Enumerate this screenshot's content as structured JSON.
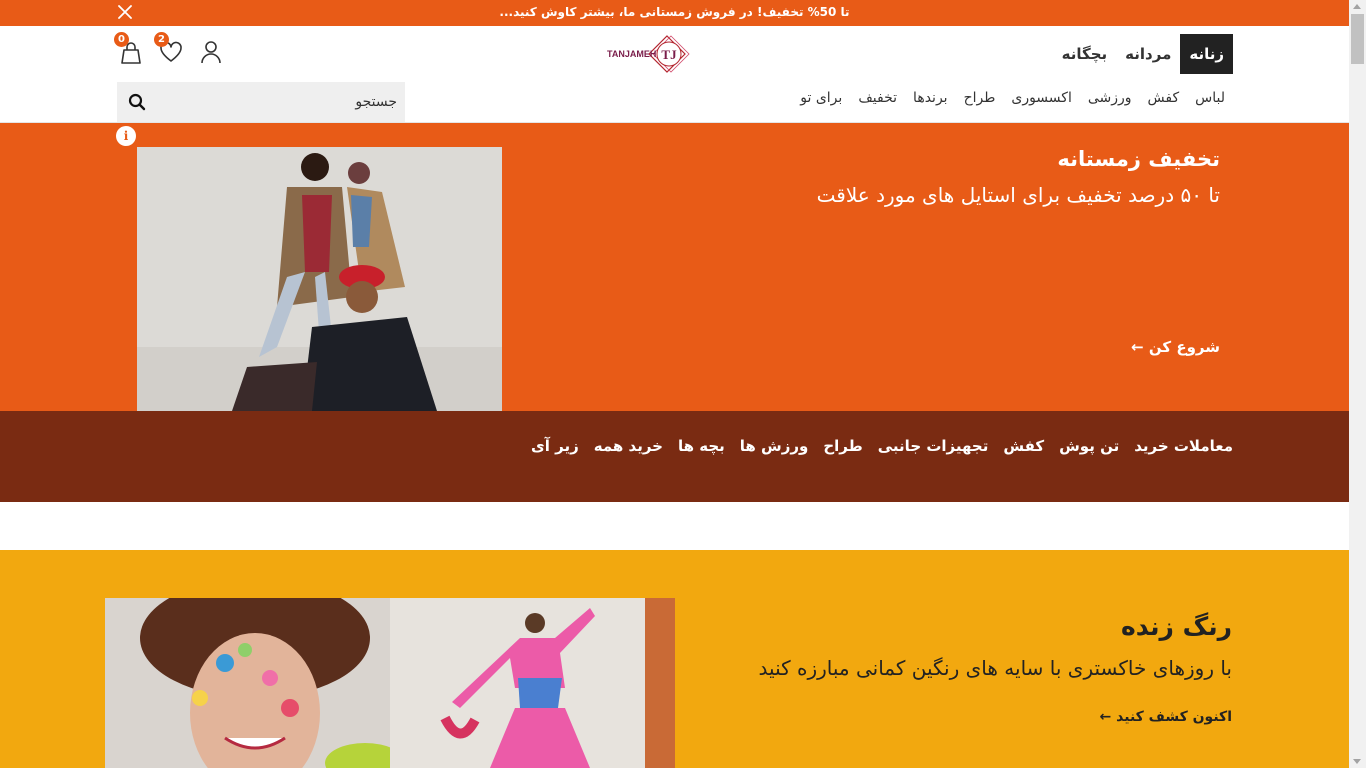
{
  "promo_bar": {
    "text": "تا 50% تخفیف! در فروش زمستانی ما، بیشتر کاوش کنید...",
    "close_icon": "close-icon"
  },
  "header": {
    "gender_tabs": [
      "زنانه",
      "مردانه",
      "بچگانه"
    ],
    "active_tab": "زنانه",
    "logo_text": "TANJAMEH",
    "logo_monogram": "TJ",
    "categories": [
      "لباس",
      "کفش",
      "ورزشی",
      "اکسسوری",
      "طراح",
      "برندها",
      "تخفیف",
      "برای تو"
    ],
    "search_placeholder": "جستجو",
    "wishlist_count": "2",
    "cart_count": "0",
    "icons": [
      "user-icon",
      "heart-icon",
      "bag-icon",
      "search-icon"
    ]
  },
  "hero": {
    "title": "تخفیف زمستانه",
    "subtitle": "تا ۵۰ درصد تخفیف برای استایل های مورد علاقت",
    "cta": "شروع کن",
    "info_icon": "i",
    "image": "winter-fashion-models-photo"
  },
  "deals_bar": {
    "links": [
      "معاملات خرید",
      "تن پوش",
      "کفش",
      "تجهیزات جانبی",
      "طراح",
      "ورزش ها",
      "بچه ها",
      "خرید همه",
      "زیر آی"
    ]
  },
  "vivid": {
    "title": "رنگ زنده",
    "subtitle": "با روزهای خاکستری با سایه های رنگین کمانی مبارزه کنید",
    "cta": "اکنون کشف کنید",
    "images": [
      "flower-face-model-photo",
      "pink-dress-model-photo"
    ]
  },
  "colors": {
    "brand_orange": "#e85b17",
    "dark_brown": "#7a2b12",
    "vivid_yellow": "#f2a80f",
    "active_tab": "#222222"
  }
}
